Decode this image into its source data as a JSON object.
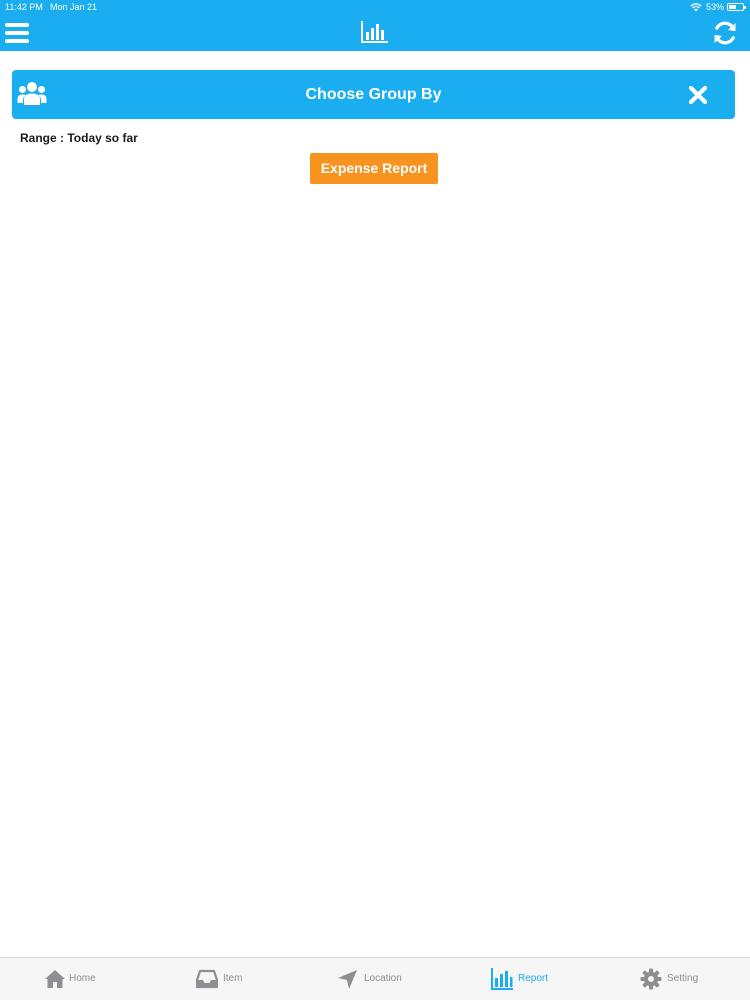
{
  "status_bar": {
    "time": "11:42 PM",
    "date": "Mon Jan 21",
    "battery_percent": "53%",
    "battery_level": 0.53
  },
  "top_nav": {
    "menu_icon": "hamburger-icon",
    "center_icon": "bar-chart-icon",
    "right_icon": "refresh-icon"
  },
  "group_by": {
    "title": "Choose Group By",
    "left_icon": "users-icon",
    "close_icon": "close-icon"
  },
  "range": {
    "text": "Range : Today so far"
  },
  "expense_button": {
    "label": "Expense Report"
  },
  "tabs": [
    {
      "label": "Home",
      "icon": "home-icon",
      "active": false
    },
    {
      "label": "Item",
      "icon": "inbox-icon",
      "active": false
    },
    {
      "label": "Location",
      "icon": "location-arrow-icon",
      "active": false
    },
    {
      "label": "Report",
      "icon": "bar-chart-icon",
      "active": true
    },
    {
      "label": "Setting",
      "icon": "gear-icon",
      "active": false
    }
  ],
  "colors": {
    "brand": "#1aaef0",
    "accent": "#f7931e",
    "tab_inactive": "#8e8e93"
  }
}
